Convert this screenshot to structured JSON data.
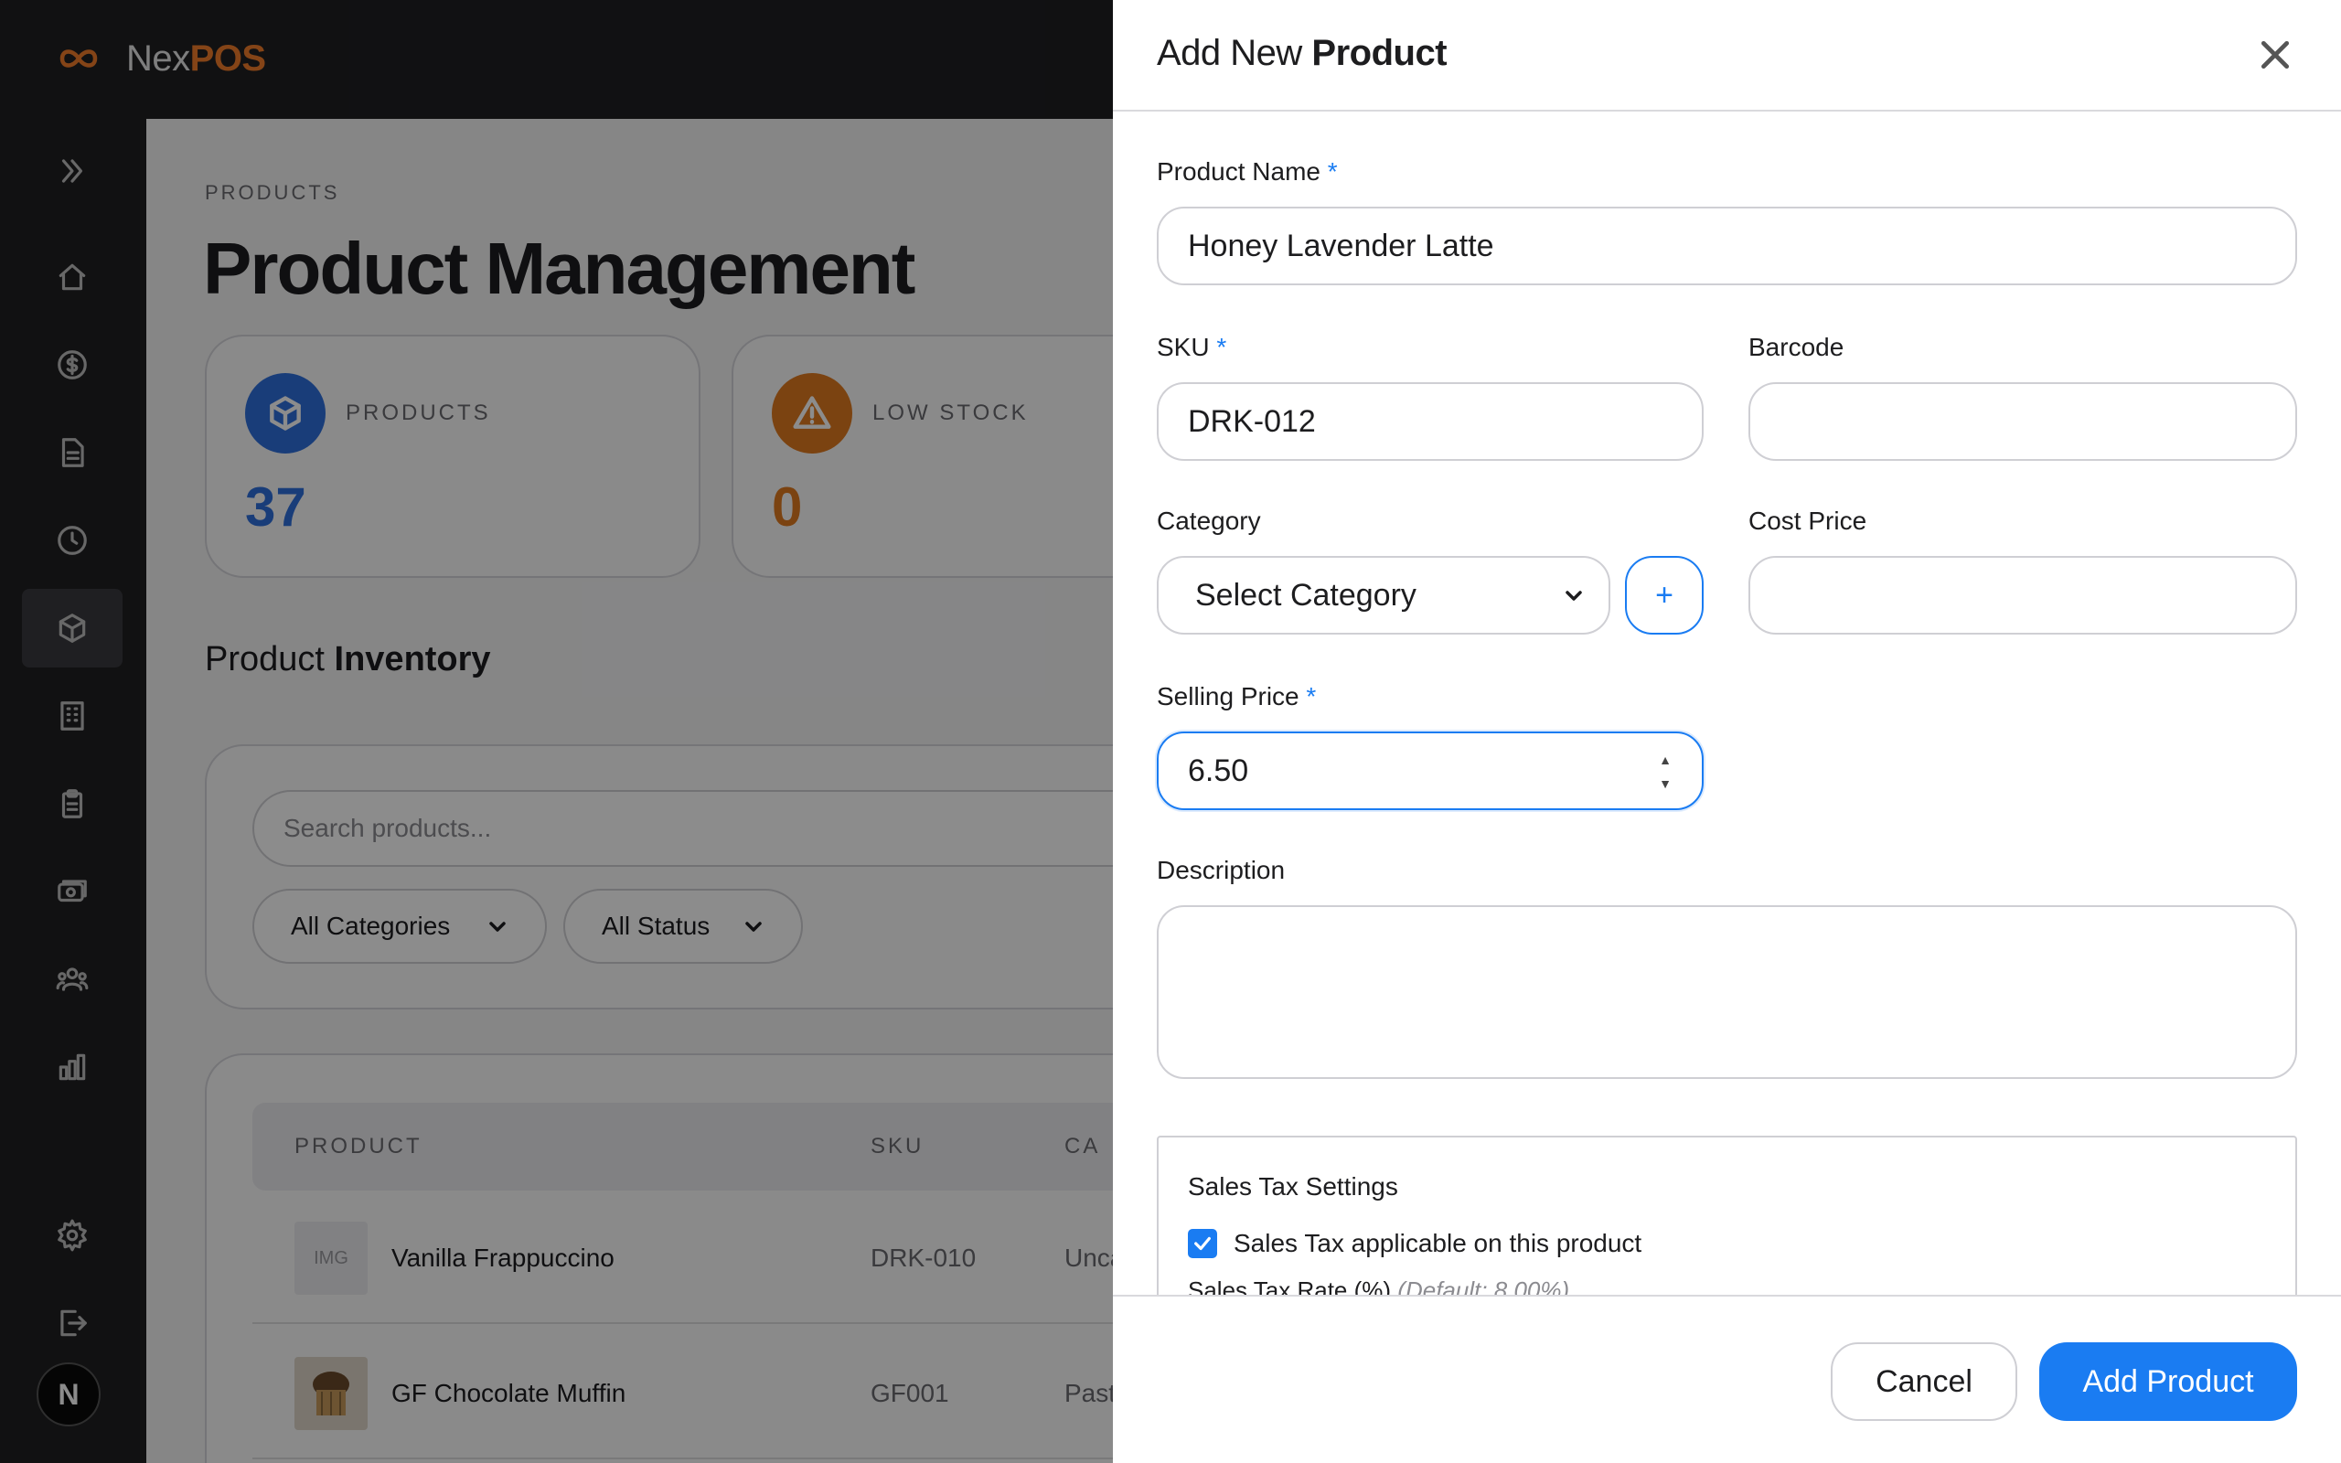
{
  "app": {
    "brand_prefix": "Nex",
    "brand_suffix": "POS",
    "accent_color": "#f07c2a",
    "primary_color": "#1a7cf2"
  },
  "sidebar": {
    "items": [
      {
        "name": "expand",
        "icon": "double-chevron-right-icon"
      },
      {
        "name": "home",
        "icon": "home-icon"
      },
      {
        "name": "sales",
        "icon": "dollar-circle-icon"
      },
      {
        "name": "orders",
        "icon": "document-icon"
      },
      {
        "name": "history",
        "icon": "clock-icon"
      },
      {
        "name": "products",
        "icon": "box-icon",
        "active": true
      },
      {
        "name": "stores",
        "icon": "building-icon"
      },
      {
        "name": "inventory",
        "icon": "clipboard-icon"
      },
      {
        "name": "payments",
        "icon": "cash-icon"
      },
      {
        "name": "customers",
        "icon": "users-icon"
      },
      {
        "name": "reports",
        "icon": "bar-chart-icon"
      },
      {
        "name": "settings",
        "icon": "gear-icon"
      },
      {
        "name": "logout",
        "icon": "logout-icon"
      }
    ],
    "avatar_letter": "N"
  },
  "main": {
    "breadcrumb": "PRODUCTS",
    "title": "Product Management",
    "stats": [
      {
        "label": "PRODUCTS",
        "value": "37",
        "color": "#2f6fdc",
        "icon": "box-icon"
      },
      {
        "label": "LOW STOCK",
        "value": "0",
        "color": "#e07a1f",
        "icon": "warning-icon"
      }
    ],
    "section_title_light": "Product ",
    "section_title_bold": "Inventory",
    "search_placeholder": "Search products...",
    "filters": {
      "category": "All Categories",
      "status": "All Status"
    },
    "table": {
      "headers": {
        "product": "PRODUCT",
        "sku": "SKU",
        "category": "CA"
      },
      "rows": [
        {
          "thumb": "IMG",
          "name": "Vanilla Frappuccino",
          "sku": "DRK-010",
          "category": "Unca"
        },
        {
          "thumb": "",
          "name": "GF Chocolate Muffin",
          "sku": "GF001",
          "category": "Past"
        }
      ]
    }
  },
  "drawer": {
    "title_light": "Add New ",
    "title_bold": "Product",
    "required_mark": "*",
    "fields": {
      "product_name": {
        "label": "Product Name",
        "value": "Honey Lavender Latte"
      },
      "sku": {
        "label": "SKU",
        "value": "DRK-012"
      },
      "barcode": {
        "label": "Barcode",
        "value": ""
      },
      "category": {
        "label": "Category",
        "selected": "Select Category"
      },
      "add_category": "+",
      "cost_price": {
        "label": "Cost Price",
        "value": ""
      },
      "selling_price": {
        "label": "Selling Price",
        "value": "6.50"
      },
      "description": {
        "label": "Description",
        "value": ""
      }
    },
    "tax": {
      "title": "Sales Tax Settings",
      "checkbox_label": "Sales Tax applicable on this product",
      "checked": true,
      "rate_label": "Sales Tax Rate (%)",
      "rate_hint": "(Default: 8.00%)"
    },
    "cancel_label": "Cancel",
    "submit_label": "Add Product"
  }
}
